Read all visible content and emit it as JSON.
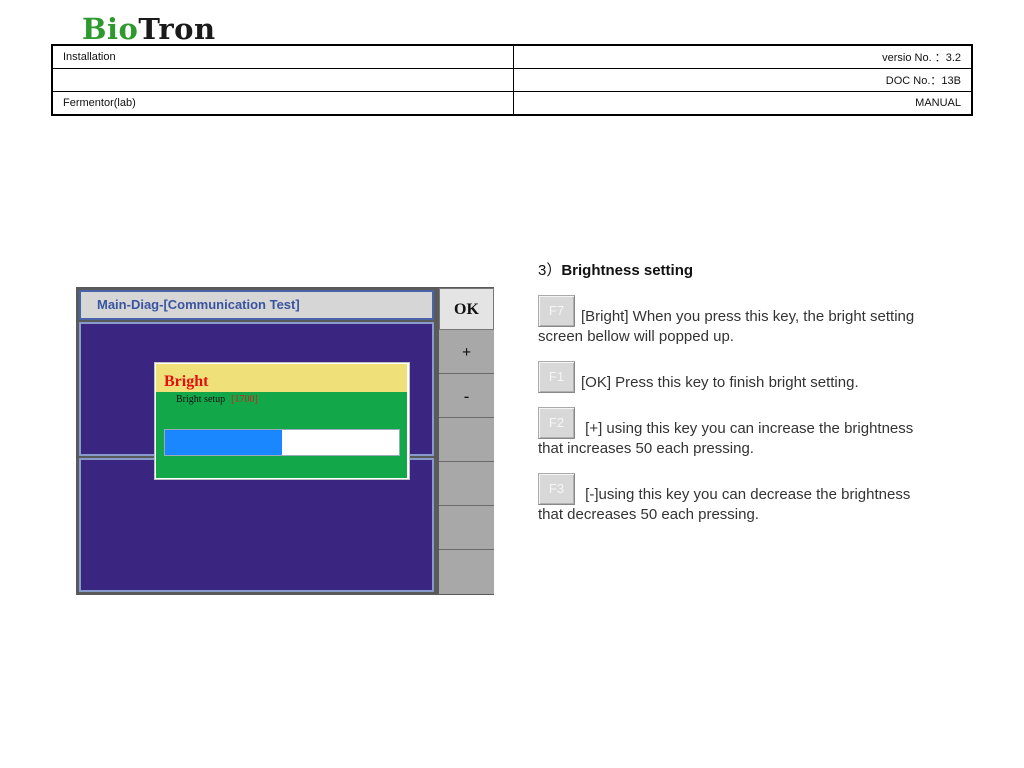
{
  "logo": {
    "part1": "Bio",
    "part2": "Tron"
  },
  "header": {
    "rows": [
      {
        "left": "Installation",
        "right": "versio No.  ：3.2"
      },
      {
        "left": "",
        "right": "DOC No.：13B"
      },
      {
        "left": "Fermentor(lab)",
        "right": "MANUAL"
      }
    ]
  },
  "screen": {
    "title": "Main-Diag-[Communication Test]",
    "keys": [
      "OK",
      "+",
      "-",
      "",
      "",
      "",
      ""
    ],
    "dialog": {
      "title": "Bright",
      "label": "Bright setup",
      "value": "[1700]",
      "level_fraction": 0.5
    }
  },
  "section": {
    "number": "3）",
    "title": "Brightness setting",
    "items": [
      {
        "key": "F7",
        "text": "[Bright] When you press this key, the bright setting screen bellow will popped up."
      },
      {
        "key": "F1",
        "text": "[OK] Press this key to finish bright setting."
      },
      {
        "key": "F2",
        "text": " [+] using this key you can increase the brightness that increases 50 each pressing."
      },
      {
        "key": "F3",
        "text": " [-]using this key you can decrease the brightness that decreases 50 each pressing."
      }
    ]
  },
  "colors": {
    "dialog_title_bg": "#f0e07a",
    "dialog_body_bg": "#12a84a",
    "bar_fill": "#1a86ff",
    "panel_bg": "#3a2680"
  }
}
